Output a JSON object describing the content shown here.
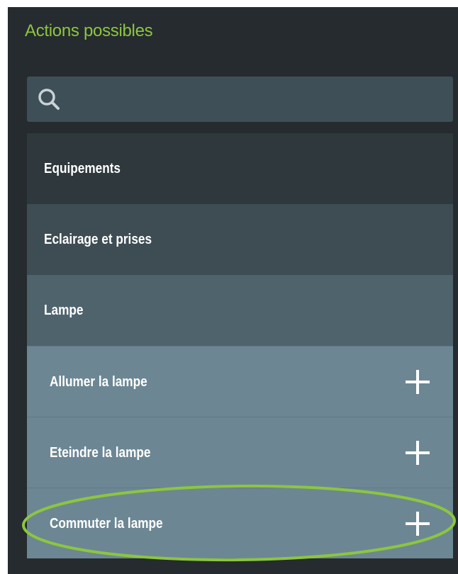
{
  "panel": {
    "title": "Actions possibles"
  },
  "search": {
    "icon": "search-icon",
    "placeholder": ""
  },
  "tree": {
    "categories": [
      {
        "label": "Equipements",
        "level": 1
      },
      {
        "label": "Eclairage et prises",
        "level": 2
      },
      {
        "label": "Lampe",
        "level": 3
      }
    ],
    "actions": [
      {
        "label": "Allumer la lampe",
        "icon": "plus-icon"
      },
      {
        "label": "Eteindre la lampe",
        "icon": "plus-icon"
      },
      {
        "label": "Commuter la lampe",
        "icon": "plus-icon",
        "highlighted": true
      }
    ]
  },
  "colors": {
    "accent": "#8cc63f",
    "panel_background": "#252b2e",
    "search_background": "#3f4f57",
    "level_1": "#2e383d",
    "level_2": "#3e4c54",
    "level_3": "#4f636d",
    "action_background": "#6c8793",
    "highlight": "#8cc63f"
  }
}
